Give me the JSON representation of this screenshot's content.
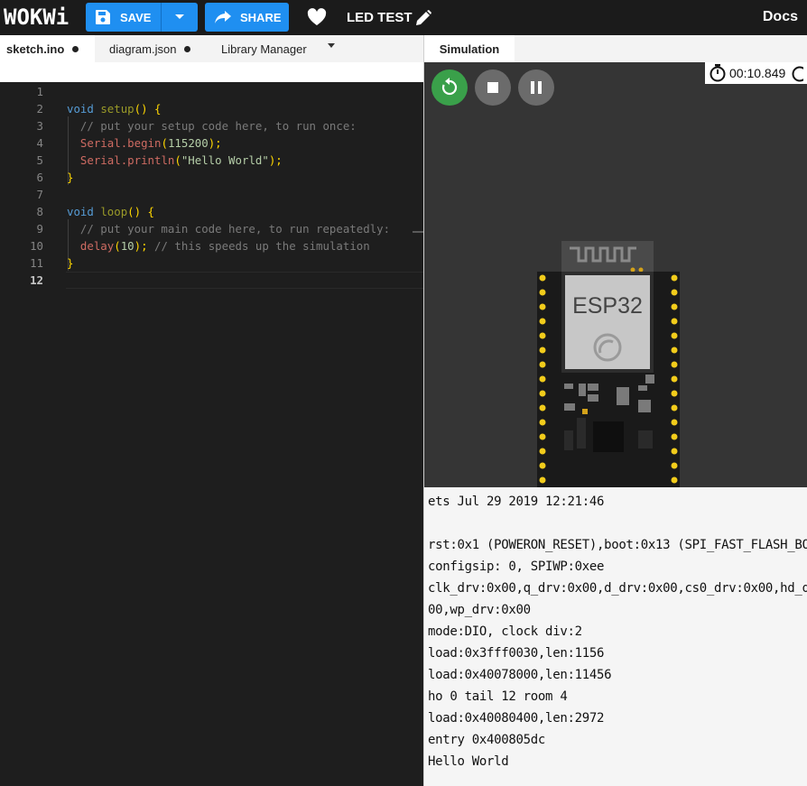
{
  "header": {
    "logo": "WOKWi",
    "save_label": "SAVE",
    "share_label": "SHARE",
    "project_title": "LED TEST",
    "docs_label": "Docs"
  },
  "editor_tabs": [
    {
      "label": "sketch.ino"
    },
    {
      "label": "diagram.json"
    },
    {
      "label": "Library Manager"
    }
  ],
  "code_lines": [
    {
      "n": "1"
    },
    {
      "n": "2"
    },
    {
      "n": "3"
    },
    {
      "n": "4"
    },
    {
      "n": "5"
    },
    {
      "n": "6"
    },
    {
      "n": "7"
    },
    {
      "n": "8"
    },
    {
      "n": "9"
    },
    {
      "n": "10"
    },
    {
      "n": "11"
    },
    {
      "n": "12"
    }
  ],
  "code": {
    "l2": [
      "void",
      " ",
      "setup",
      "()",
      " ",
      "{"
    ],
    "l3": "  // put your setup code here, to run once:",
    "l4": [
      "  ",
      "Serial",
      ".",
      "begin",
      "(",
      "115200",
      ");"
    ],
    "l5": [
      "  ",
      "Serial",
      ".",
      "println",
      "(",
      "\"Hello World\"",
      ");"
    ],
    "l6": "}",
    "l8": [
      "void",
      " ",
      "loop",
      "()",
      " ",
      "{"
    ],
    "l9": "  // put your main code here, to run repeatedly:",
    "l10": [
      "  ",
      "delay",
      "(",
      "10",
      ");",
      " ",
      "// this speeds up the simulation"
    ],
    "l11": "}"
  },
  "simulation": {
    "tab_label": "Simulation",
    "timer": "00:10.849",
    "board_label": "ESP32"
  },
  "serial_output": [
    "ets Jul 29 2019 12:21:46",
    "",
    "rst:0x1 (POWERON_RESET),boot:0x13 (SPI_FAST_FLASH_BO",
    "configsip: 0, SPIWP:0xee",
    "clk_drv:0x00,q_drv:0x00,d_drv:0x00,cs0_drv:0x00,hd_d",
    "00,wp_drv:0x00",
    "mode:DIO, clock div:2",
    "load:0x3fff0030,len:1156",
    "load:0x40078000,len:11456",
    "ho 0 tail 12 room 4",
    "load:0x40080400,len:2972",
    "entry 0x400805dc",
    "Hello World"
  ]
}
